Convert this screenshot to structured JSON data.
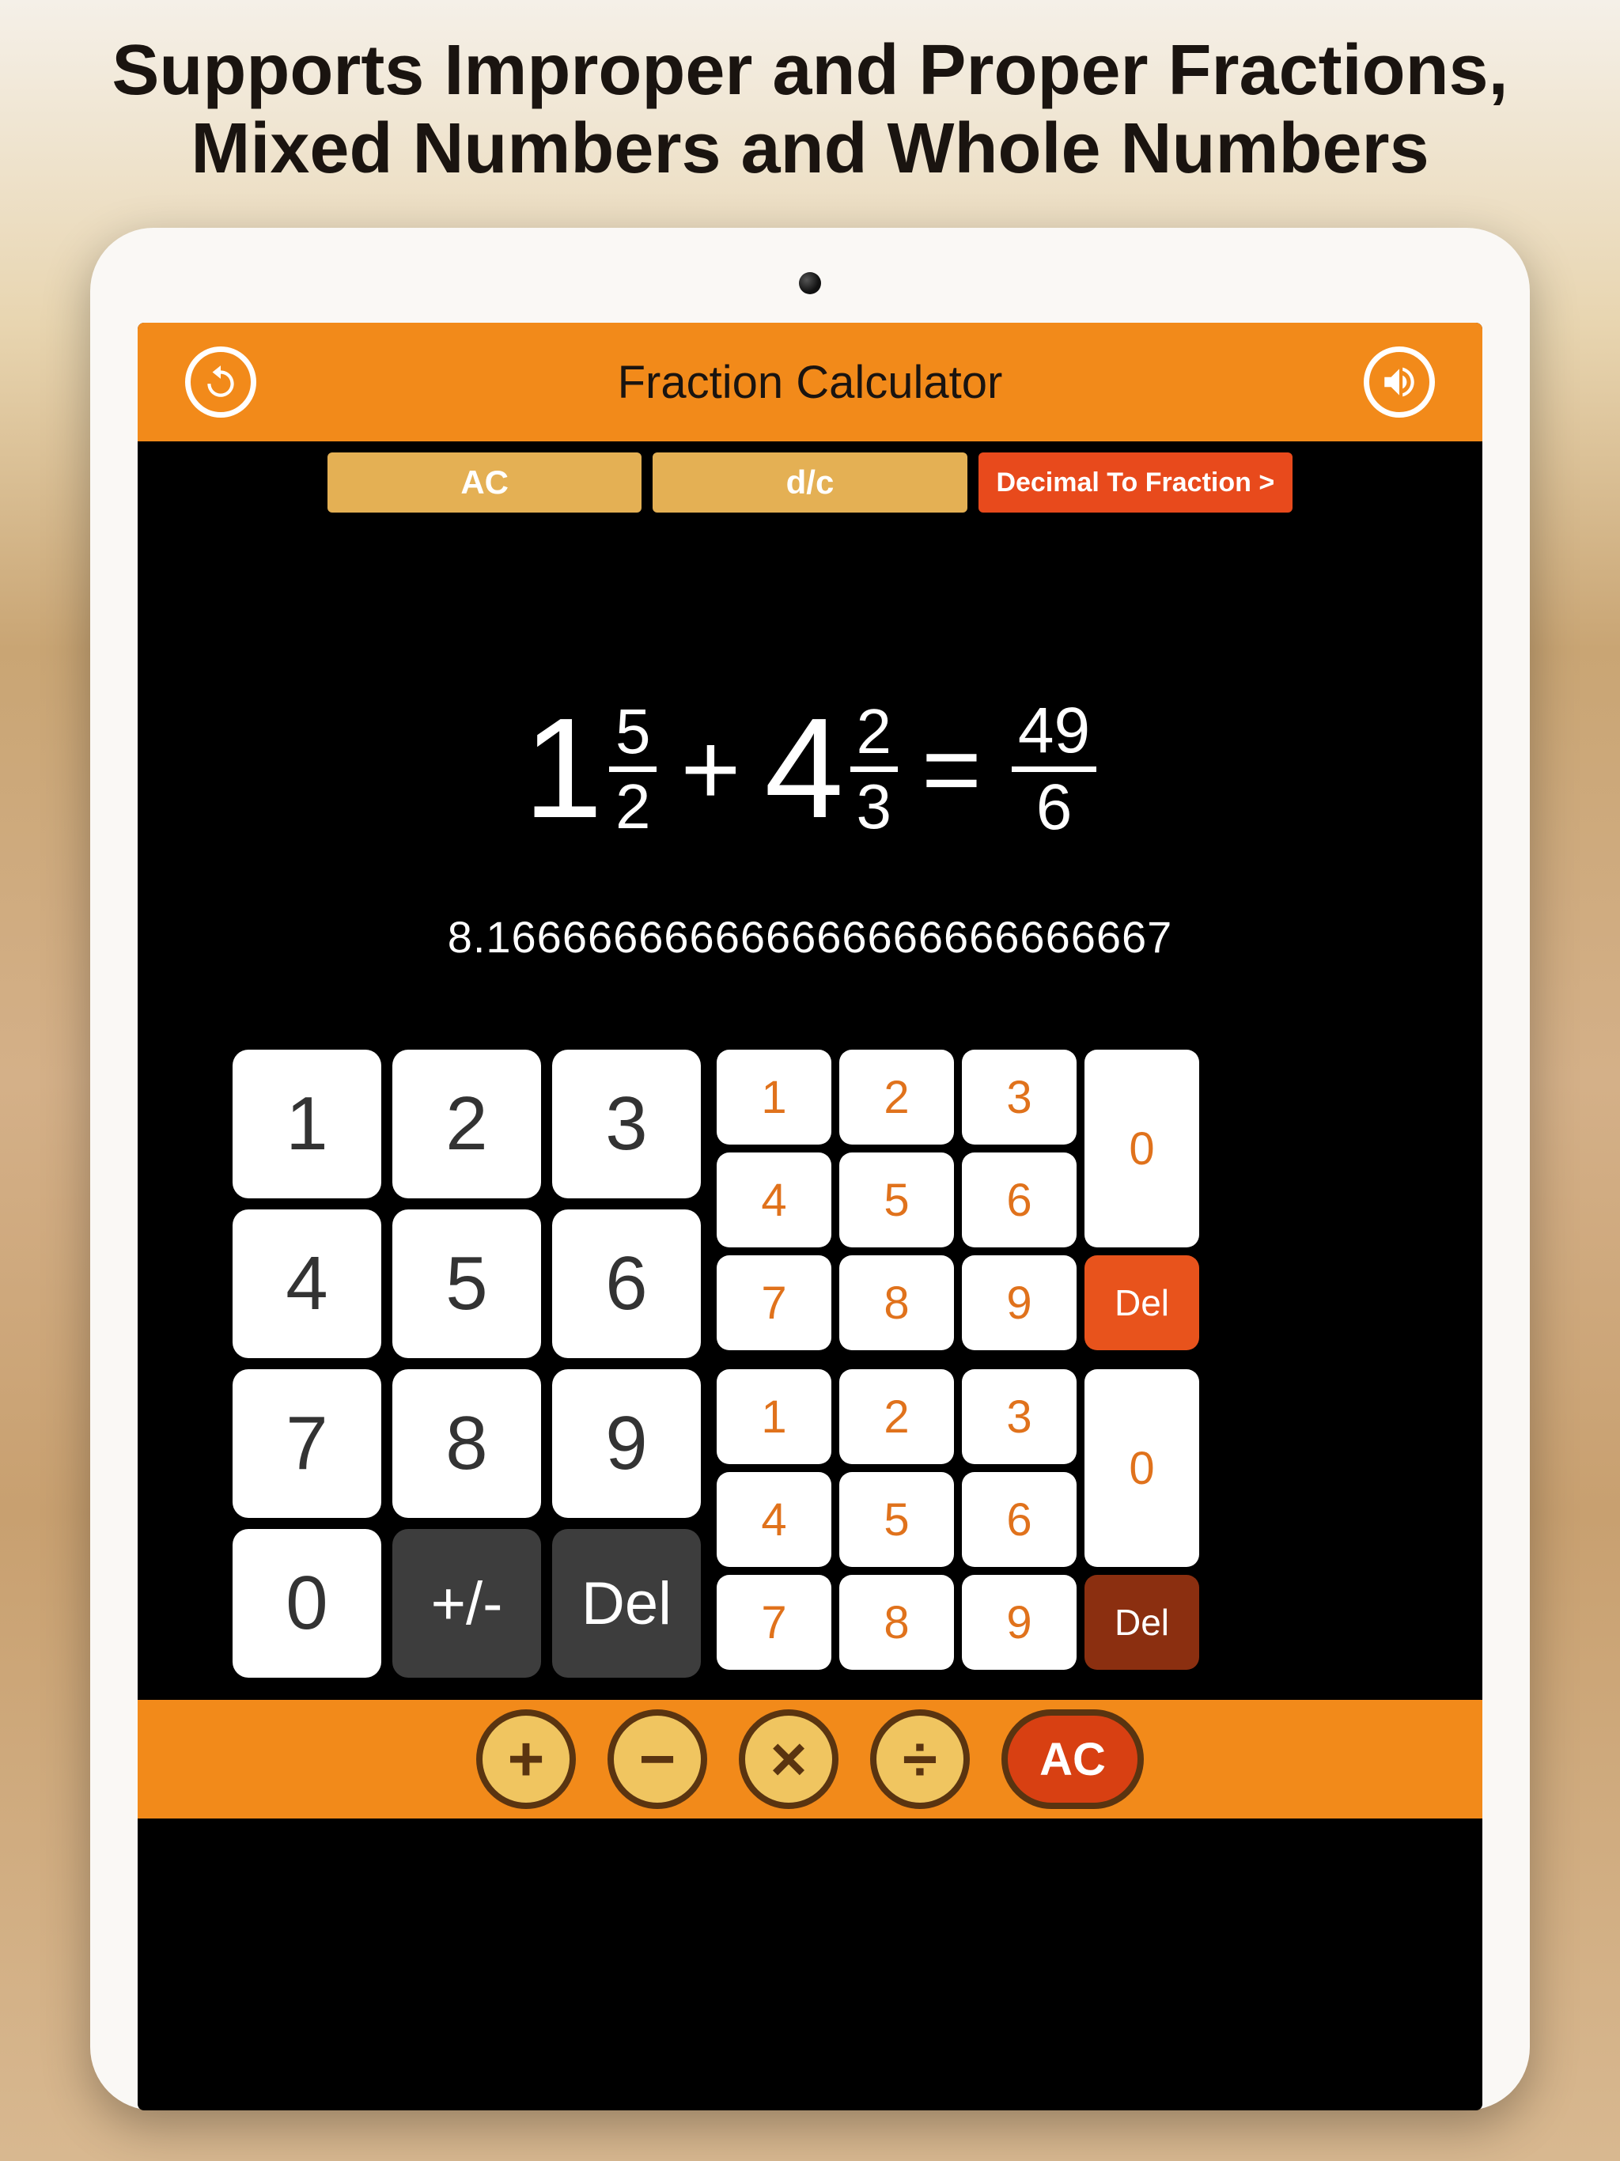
{
  "headline": "Supports Improper and Proper Fractions, Mixed Numbers and Whole Numbers",
  "topbar": {
    "title": "Fraction Calculator"
  },
  "tabs": {
    "ac": "AC",
    "dc": "d/c",
    "dec": "Decimal To Fraction  >"
  },
  "equation": {
    "term1": {
      "whole": "1",
      "num": "5",
      "den": "2"
    },
    "op": "+",
    "term2": {
      "whole": "4",
      "num": "2",
      "den": "3"
    },
    "eq": "=",
    "result": {
      "num": "49",
      "den": "6"
    }
  },
  "decimal": "8.166666666666666666666666667",
  "mainKeys": [
    "1",
    "2",
    "3",
    "4",
    "5",
    "6",
    "7",
    "8",
    "9",
    "0",
    "+/-",
    "Del"
  ],
  "smallPad": {
    "row1": [
      "1",
      "2",
      "3"
    ],
    "row2": [
      "4",
      "5",
      "6"
    ],
    "row3": [
      "7",
      "8",
      "9"
    ],
    "zero": "0",
    "del": "Del"
  },
  "ops": {
    "plus": "+",
    "minus": "−",
    "mult": "×",
    "div": "÷",
    "ac": "AC"
  }
}
